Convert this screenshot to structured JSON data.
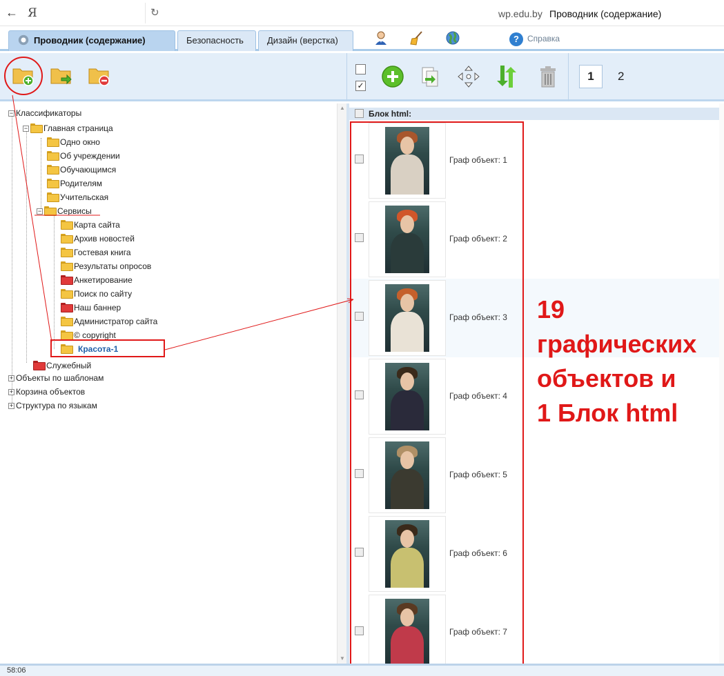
{
  "browser": {
    "back_icon": "back-arrow-icon",
    "yandex_letter": "Я",
    "reload_icon": "reload-icon",
    "domain": "wp.edu.by",
    "page_title": "Проводник (содержание)"
  },
  "tabs": [
    {
      "label": "Проводник (содержание)",
      "active": true
    },
    {
      "label": "Безопасность",
      "active": false
    },
    {
      "label": "Дизайн (верстка)",
      "active": false
    }
  ],
  "tab_tools": {
    "user_icon": "user-icon",
    "broom_icon": "broom-icon",
    "globe_icon": "globe-icon",
    "help_label": "Справка"
  },
  "toolbar": {
    "left_buttons": [
      "add-folder-icon",
      "move-folder-icon",
      "delete-folder-icon"
    ],
    "right_buttons": [
      "add-icon",
      "copy-icon",
      "move-icon",
      "sort-icon",
      "trash-icon"
    ],
    "pages": [
      "1",
      "2"
    ],
    "current_page": "1"
  },
  "tree": {
    "root": "Классификаторы",
    "main_page": "Главная страница",
    "main_children": [
      "Одно окно",
      "Об учреждении",
      "Обучающимся",
      "Родителям",
      "Учительская"
    ],
    "services": "Сервисы",
    "services_children": [
      {
        "label": "Карта сайта",
        "red": false
      },
      {
        "label": "Архив новостей",
        "red": false
      },
      {
        "label": "Гостевая книга",
        "red": false
      },
      {
        "label": "Результаты опросов",
        "red": false
      },
      {
        "label": "Анкетирование",
        "red": true
      },
      {
        "label": "Поиск по сайту",
        "red": false
      },
      {
        "label": "Наш баннер",
        "red": true
      },
      {
        "label": "Администратор сайта",
        "red": false
      },
      {
        "label": "© copyright",
        "red": false
      },
      {
        "label": "Красота-1",
        "red": false,
        "selected": true
      }
    ],
    "service_folder": "Служебный",
    "other_roots": [
      "Объекты по шаблонам",
      "Корзина объектов",
      "Структура по языкам"
    ]
  },
  "content": {
    "block_header": "Блок html:",
    "objects": [
      "Граф объект: 1",
      "Граф объект: 2",
      "Граф объект: 3",
      "Граф объект: 4",
      "Граф объект: 5",
      "Граф объект: 6",
      "Граф объект: 7"
    ]
  },
  "annotation": {
    "lines": [
      "19",
      "графических",
      "объектов и",
      "1 Блок html"
    ],
    "color": "#e01818"
  },
  "status": {
    "time": "58:06"
  }
}
